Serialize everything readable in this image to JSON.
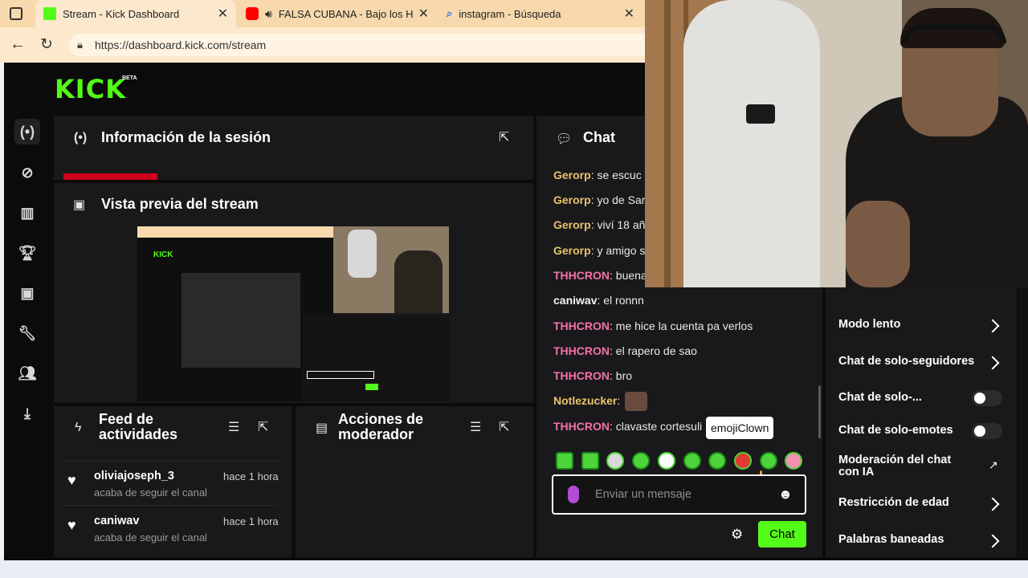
{
  "browser": {
    "tabs": [
      {
        "title": "Stream - Kick Dashboard",
        "icon": "kick-favicon"
      },
      {
        "title": "FALSA CUBANA - Bajo los H",
        "icon": "youtube-favicon"
      },
      {
        "title": "instagram - Búsqueda",
        "icon": "search-favicon"
      }
    ],
    "url": "https://dashboard.kick.com/stream"
  },
  "header": {
    "logo": "KICK",
    "beta": "BETA"
  },
  "session": {
    "title": "Información de la sesión"
  },
  "preview": {
    "title": "Vista previa del stream"
  },
  "feed": {
    "title_line1": "Feed de",
    "title_line2": "actividades",
    "items": [
      {
        "name": "oliviajoseph_3",
        "sub": "acaba de seguir el canal",
        "time": "hace 1 hora"
      },
      {
        "name": "caniwav",
        "sub": "acaba de seguir el canal",
        "time": "hace 1 hora"
      }
    ]
  },
  "mod_actions": {
    "title_line1": "Acciones de",
    "title_line2": "moderador"
  },
  "chat": {
    "title": "Chat",
    "messages": [
      {
        "user": "Gerorp",
        "text": "se escuc",
        "color": "#e9c46a"
      },
      {
        "user": "Gerorp",
        "text": "yo de Sar",
        "color": "#e9c46a"
      },
      {
        "user": "Gerorp",
        "text": "viví 18 añ",
        "color": "#e9c46a"
      },
      {
        "user": "Gerorp",
        "text": "y amigo s",
        "color": "#e9c46a"
      },
      {
        "user": "THHCRON",
        "text": "buena",
        "color": "#f472a8"
      },
      {
        "user": "caniwav",
        "text": "el ronnn",
        "color": "#f5f5f5"
      },
      {
        "user": "THHCRON",
        "text": "me hice la cuenta pa verlos",
        "color": "#f472a8"
      },
      {
        "user": "THHCRON",
        "text": "el rapero de sao",
        "color": "#f472a8"
      },
      {
        "user": "THHCRON",
        "text": "bro",
        "color": "#f472a8"
      },
      {
        "user": "Notlezucker",
        "text": "",
        "color": "#e9c46a"
      },
      {
        "user": "THHCRON",
        "text": "clavaste cortesuli",
        "color": "#f472a8"
      }
    ],
    "tooltip": "emojiClown",
    "input_placeholder": "Enviar un mensaje",
    "send_label": "Chat"
  },
  "mod_settings": {
    "items": [
      {
        "label": "Modo lento",
        "control": "chevron"
      },
      {
        "label": "Chat de solo-seguidores",
        "control": "chevron"
      },
      {
        "label": "Chat de solo-...",
        "control": "toggle"
      },
      {
        "label": "Chat de solo-emotes",
        "control": "toggle"
      },
      {
        "label": "Moderación del chat con IA",
        "control": "external"
      },
      {
        "label": "Restricción de edad",
        "control": "chevron"
      },
      {
        "label": "Palabras baneadas",
        "control": "chevron"
      }
    ]
  },
  "colors": {
    "accent": "#53fc18",
    "panel": "#19191b",
    "bg": "#0b0b0c"
  }
}
